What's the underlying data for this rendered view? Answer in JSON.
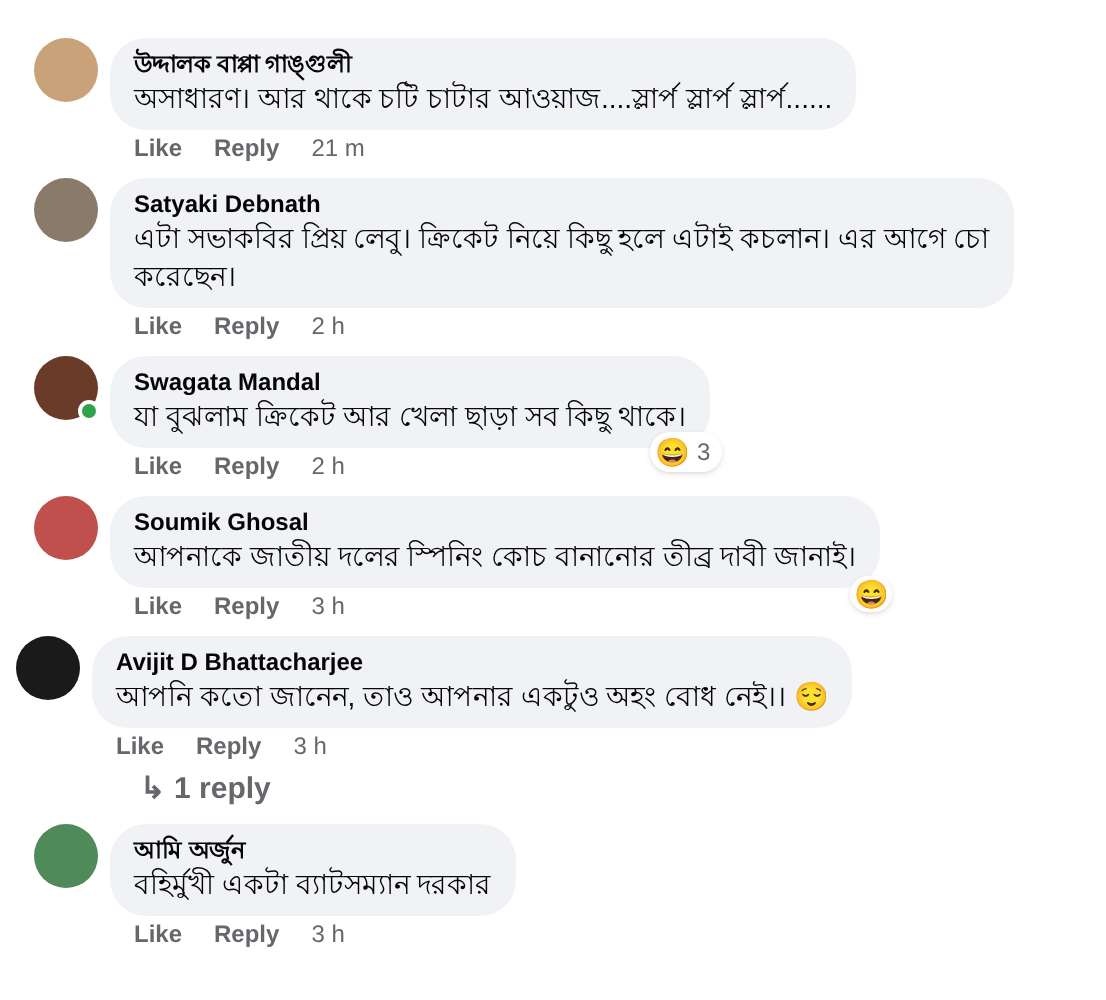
{
  "comments": [
    {
      "kind": "normal",
      "author": "উদ্দালক বাপ্পা গাঙ্গুলী",
      "lines": [
        "অসাধারণ। আর থাকে চটি চাটার আওয়াজ....স্লার্প স্লার্প স্লার্প......"
      ],
      "online": false,
      "like": "Like",
      "reply": "Reply",
      "time": "21 m"
    },
    {
      "kind": "normal",
      "author": "Satyaki Debnath",
      "lines": [
        "এটা সভাকবির প্রিয় লেবু। ক্রিকেট নিয়ে কিছু হলে এটাই কচলান। এর আগে চো",
        "করেছেন।"
      ],
      "online": false,
      "like": "Like",
      "reply": "Reply",
      "time": "2 h"
    },
    {
      "kind": "normal",
      "author": "Swagata Mandal",
      "lines": [
        "যা বুঝলাম ক্রিকেট আর খেলা ছাড়া সব কিছু থাকে।"
      ],
      "online": true,
      "reaction": {
        "emoji": "😄",
        "count": "3"
      },
      "like": "Like",
      "reply": "Reply",
      "time": "2 h"
    },
    {
      "kind": "normal",
      "author": "Soumik Ghosal",
      "lines": [
        "আপনাকে জাতীয় দলের স্পিনিং কোচ বানানোর তীব্র দাবী জানাই।"
      ],
      "online": false,
      "reaction": {
        "emoji": "😄"
      },
      "like": "Like",
      "reply": "Reply",
      "time": "3 h"
    },
    {
      "kind": "pasted",
      "author": "Avijit D Bhattacharjee",
      "lines": [
        "আপনি কতো জানেন, তাও আপনার একটুও অহং বোধ নেই।। 😌"
      ],
      "online": false,
      "like": "Like",
      "reply": "Reply",
      "time": "3 h",
      "replies": {
        "arrow": "↳",
        "label": "1 reply"
      }
    },
    {
      "kind": "normal",
      "author": "আমি অর্জুন",
      "lines": [
        "বহির্মুখী একটা ব্যাটসম্যান দরকার"
      ],
      "online": false,
      "like": "Like",
      "reply": "Reply",
      "time": "3 h"
    }
  ]
}
